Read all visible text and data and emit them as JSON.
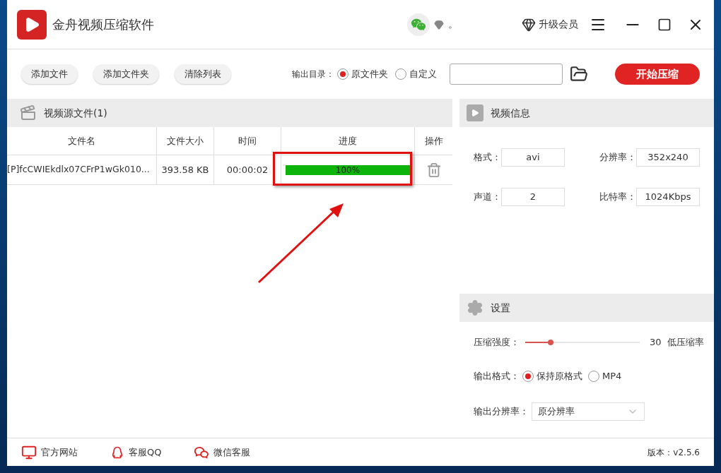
{
  "window": {
    "title": "金舟视频压缩软件",
    "status_text": "。",
    "upgrade": "升级会员"
  },
  "toolbar": {
    "buttons": [
      "添加文件",
      "添加文件夹",
      "清除列表"
    ],
    "output_label": "输出目录：",
    "output_options": [
      {
        "label": "原文件夹",
        "selected": true
      },
      {
        "label": "自定义",
        "selected": false
      }
    ],
    "start_button": "开始压缩"
  },
  "file_panel": {
    "title": "视频源文件(1)",
    "columns": [
      "文件名",
      "文件大小",
      "时间",
      "进度",
      "操作"
    ],
    "rows": [
      {
        "name": "[P]fcCWIEkdlx07CFrP1wGk010...",
        "size": "393.58 KB",
        "time": "00:00:02",
        "level": 1,
        "progress_text": "100%"
      }
    ]
  },
  "info_panel": {
    "title": "视频信息",
    "fields": [
      {
        "label": "格式：",
        "value": "avi"
      },
      {
        "label": "分辨率：",
        "value": "352x240"
      },
      {
        "label": "声道：",
        "value": "2"
      },
      {
        "label": "比特率：",
        "value": "1024Kbps"
      }
    ]
  },
  "settings": {
    "title": "设置",
    "strength_label": "压缩强度：",
    "strength": {
      "level": 0.22
    },
    "strength_value": "30",
    "strength_text": "低压缩率",
    "format_label": "输出格式：",
    "format_options": [
      {
        "label": "保持原格式",
        "selected": true
      },
      {
        "label": "MP4",
        "selected": false
      }
    ],
    "resolution_label": "输出分辨率：",
    "resolution_value": "原分辨率"
  },
  "footer": {
    "links": [
      "官方网站",
      "客服QQ",
      "微信客服"
    ],
    "version": "版本：v2.5.6"
  }
}
